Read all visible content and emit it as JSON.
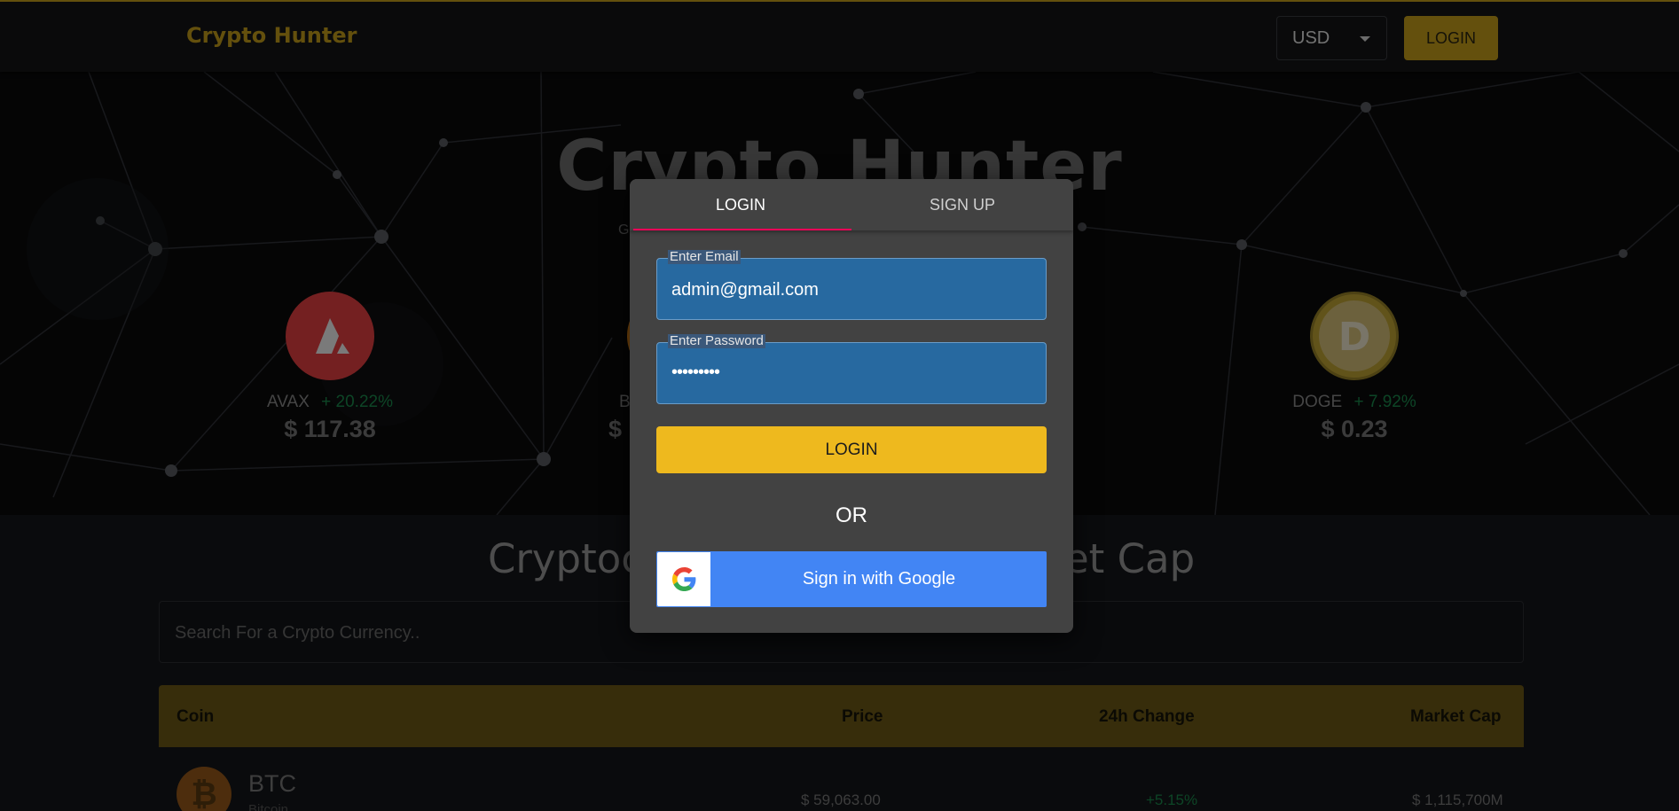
{
  "header": {
    "brand": "Crypto Hunter",
    "currency": "USD",
    "login_label": "LOGIN"
  },
  "banner": {
    "title": "Crypto Hunter",
    "subtitle": "G",
    "coins": [
      {
        "symbol": "AVAX",
        "change": "+ 20.22%",
        "price": "$ 117.38",
        "logo": "avax-logo-icon",
        "color": "#e84142"
      },
      {
        "symbol": "B",
        "change": "",
        "price": "$",
        "logo": "coin-logo-icon",
        "color": "#f7931a"
      },
      {
        "symbol": "DOGE",
        "change": "+ 7.92%",
        "price": "$ 0.23",
        "logo": "doge-logo-icon",
        "color": "#c3a634"
      }
    ]
  },
  "section": {
    "title_left": "Cryptoc",
    "title_right": "et Cap"
  },
  "search": {
    "placeholder": "Search For a Crypto Currency.."
  },
  "table": {
    "headers": [
      "Coin",
      "Price",
      "24h Change",
      "Market Cap"
    ],
    "rows": [
      {
        "symbol": "BTC",
        "name": "Bitcoin",
        "price": "$ 59,063.00",
        "change": "+5.15%",
        "market_cap": "$ 1,115,700M"
      }
    ]
  },
  "modal": {
    "tabs": [
      "LOGIN",
      "SIGN UP"
    ],
    "active_tab": "LOGIN",
    "email_label": "Enter Email",
    "email_value": "admin@gmail.com",
    "password_label": "Enter Password",
    "password_value": "•••••••••",
    "login_button": "LOGIN",
    "or_text": "OR",
    "google_button": "Sign in with Google"
  },
  "colors": {
    "accent": "#c9a11b",
    "login_button": "#eeb91e",
    "google_blue": "#4285f4",
    "tab_indicator": "#f50057",
    "positive": "#1a8a4c"
  }
}
